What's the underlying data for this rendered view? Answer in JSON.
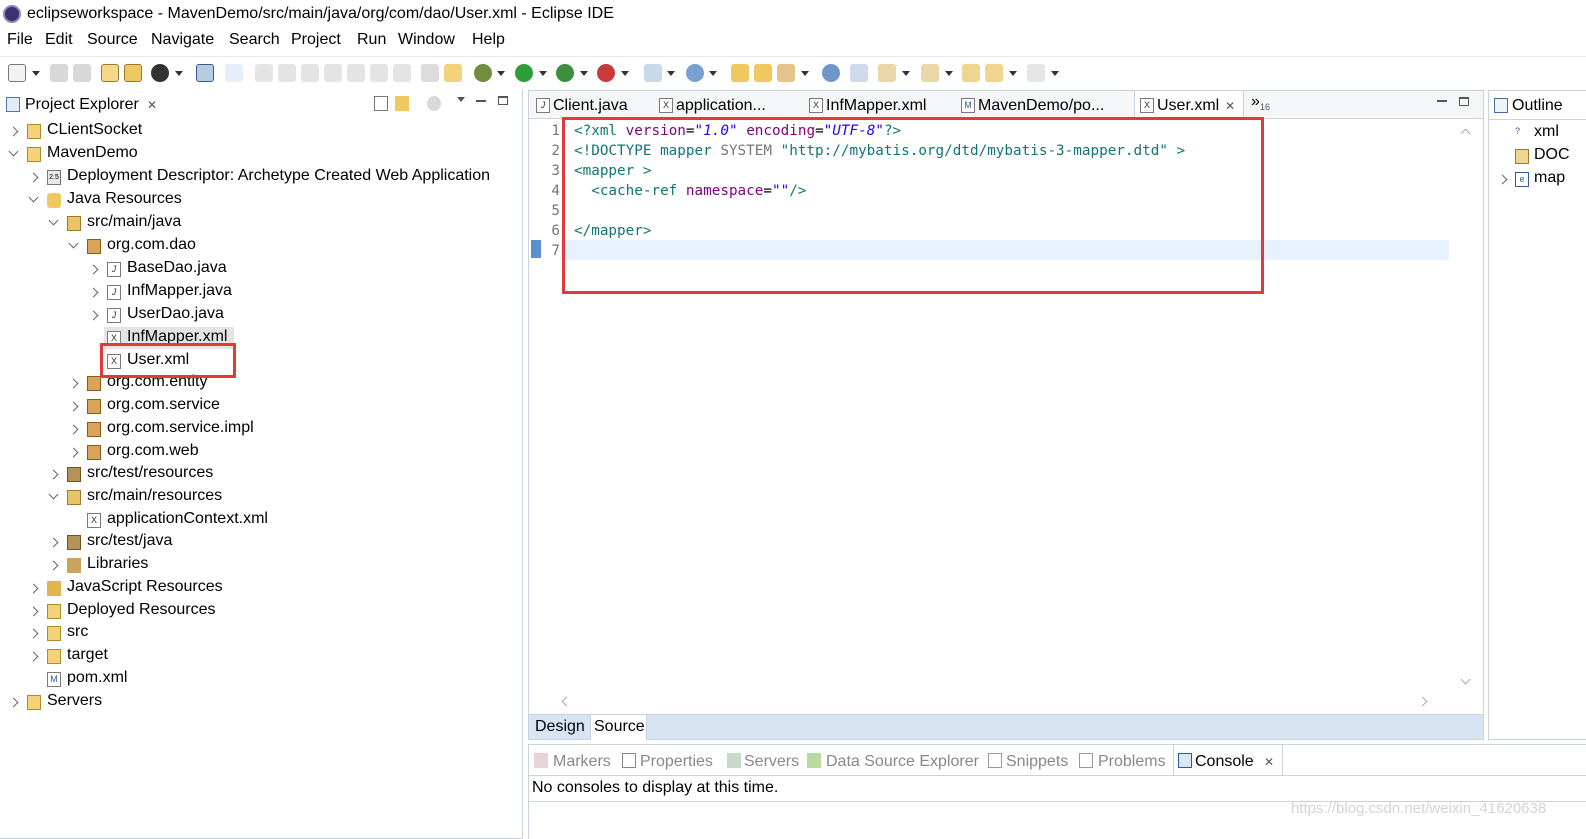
{
  "window": {
    "title": "eclipseworkspace - MavenDemo/src/main/java/org/com/dao/User.xml - Eclipse IDE"
  },
  "menu": [
    "File",
    "Edit",
    "Source",
    "Navigate",
    "Search",
    "Project",
    "Run",
    "Window",
    "Help"
  ],
  "project_explorer": {
    "title": "Project Explorer",
    "close": "✕",
    "items": [
      "CLientSocket",
      "MavenDemo",
      "Deployment Descriptor: Archetype Created Web Application",
      "Java Resources",
      "src/main/java",
      "org.com.dao",
      "BaseDao.java",
      "InfMapper.java",
      "UserDao.java",
      "InfMapper.xml",
      "User.xml",
      "org.com.entity",
      "org.com.service",
      "org.com.service.impl",
      "org.com.web",
      "src/test/resources",
      "src/main/resources",
      "applicationContext.xml",
      "src/test/java",
      "Libraries",
      "JavaScript Resources",
      "Deployed Resources",
      "src",
      "target",
      "pom.xml",
      "Servers"
    ],
    "badge_j2ee": "2.5"
  },
  "editor": {
    "tabs": [
      "Client.java",
      "application...",
      "InfMapper.xml",
      "MavenDemo/po...",
      "User.xml"
    ],
    "active_tab": "User.xml",
    "overflow": "»",
    "overflow_count": "16",
    "line_numbers": [
      "1",
      "2",
      "3",
      "4",
      "5",
      "6",
      "7"
    ],
    "code": {
      "l1_open": "<?",
      "l1_xml": "xml",
      "l1_sp1": " ",
      "l1_attr1": "version",
      "l1_eq1": "=",
      "l1_val1": "\"1.0\"",
      "l1_sp2": " ",
      "l1_attr2": "encoding",
      "l1_eq2": "=",
      "l1_val2": "\"UTF-8\"",
      "l1_close": "?>",
      "l2_open": "<!DOCTYPE",
      "l2_name": " mapper ",
      "l2_sys": "SYSTEM",
      "l2_sp": " ",
      "l2_url": "\"http://mybatis.org/dtd/mybatis-3-mapper.dtd\"",
      "l2_close": " >",
      "l3": "<mapper >",
      "l4_indent": "  ",
      "l4_tag": "<cache-ref",
      "l4_sp": " ",
      "l4_attr": "namespace",
      "l4_eq": "=",
      "l4_val": "\"\"",
      "l4_close": "/>",
      "l6": "</mapper>"
    },
    "bottom_tabs": [
      "Design",
      "Source"
    ]
  },
  "outline": {
    "title": "Outline",
    "items": [
      "xml",
      "DOC",
      "map"
    ]
  },
  "bottom_panel": {
    "tabs": [
      "Markers",
      "Properties",
      "Servers",
      "Data Source Explorer",
      "Snippets",
      "Problems",
      "Console"
    ],
    "active_tab": "Console",
    "close": "✕",
    "message": "No consoles to display at this time."
  },
  "watermark": "https://blog.csdn.net/weixin_41620638",
  "colors": {
    "highlight": "#e03a3a",
    "panel_border": "#c9d3de",
    "xml_tag": "#117575",
    "xml_attr": "#7f007f",
    "xml_value": "#2a00ff"
  }
}
